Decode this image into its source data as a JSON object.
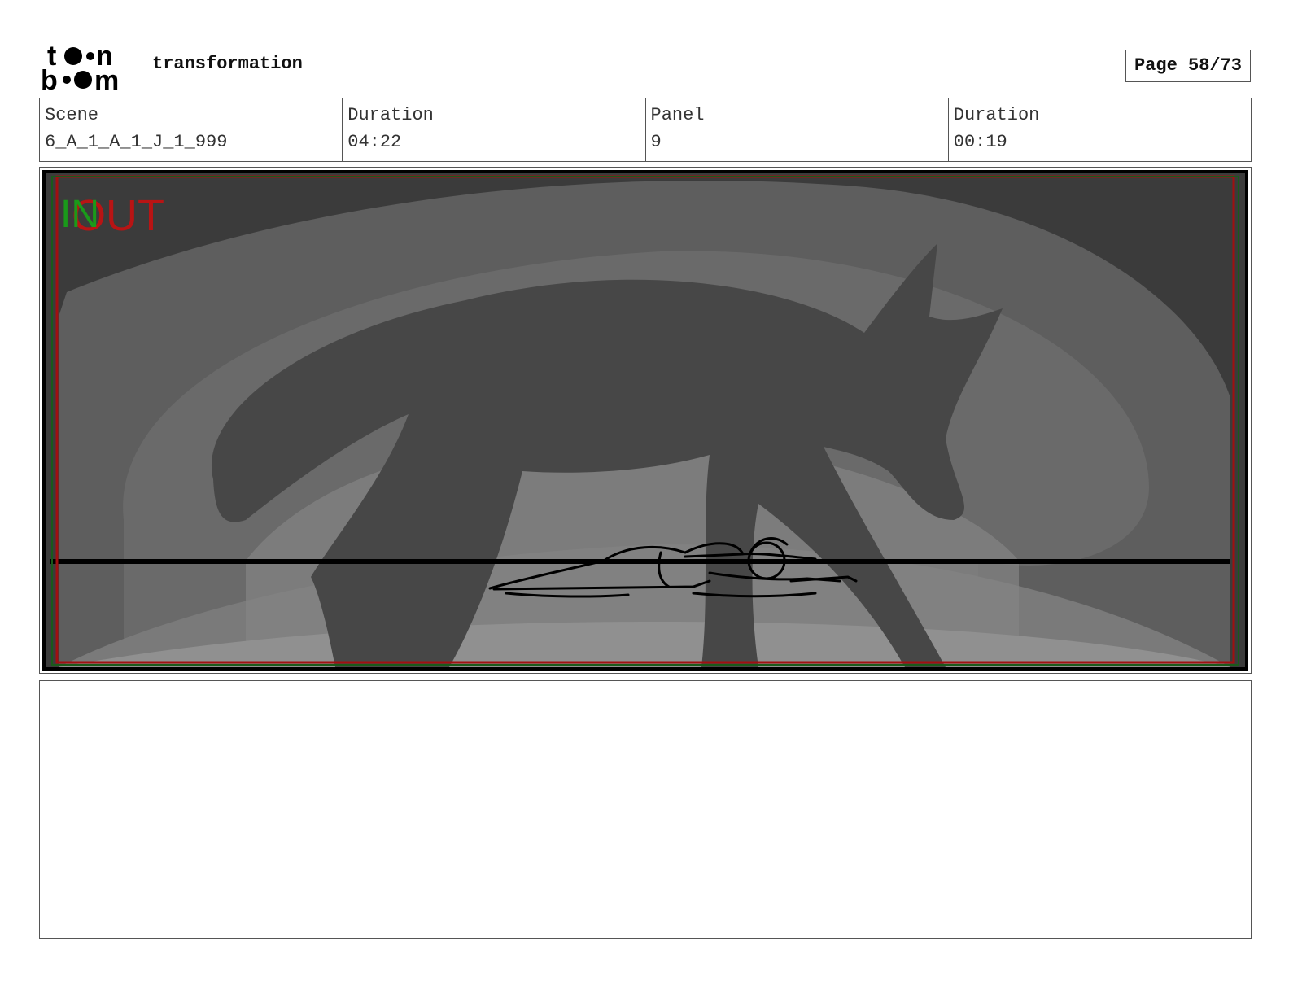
{
  "header": {
    "brand": "toon boom",
    "project_title": "transformation",
    "page_label": "Page 58/73"
  },
  "info": {
    "scene_label": "Scene",
    "scene_value": "6_A_1_A_1_J_1_999",
    "scene_duration_label": "Duration",
    "scene_duration_value": "04:22",
    "panel_label": "Panel",
    "panel_value": "9",
    "panel_duration_label": "Duration",
    "panel_duration_value": "00:19"
  },
  "panel": {
    "in_marker": "IN",
    "out_marker": "OUT",
    "colors": {
      "in_marker": "#1a9a1a",
      "out_marker": "#b81414",
      "frame_border": "#a01010",
      "background": "#3b3b3b"
    }
  },
  "notes": {
    "text": ""
  }
}
